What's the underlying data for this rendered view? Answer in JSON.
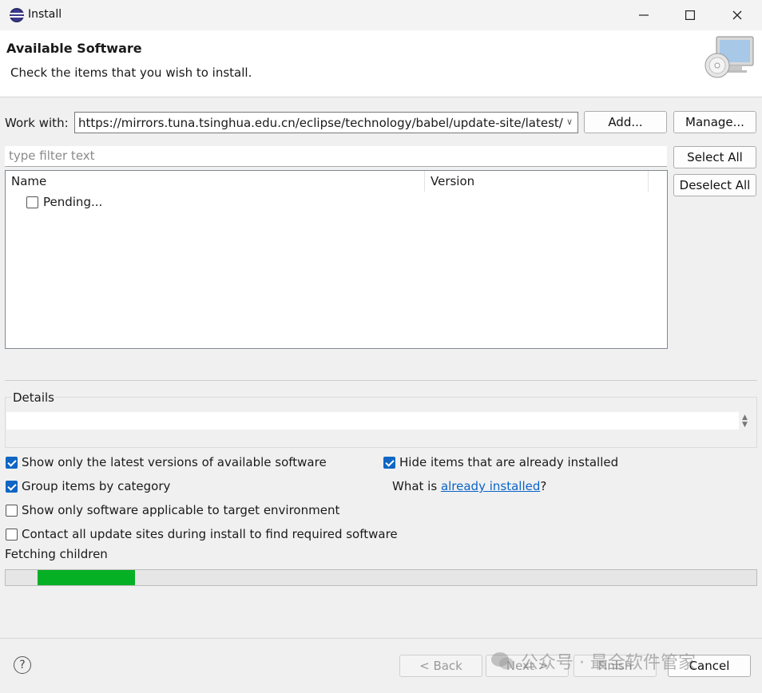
{
  "window": {
    "title": "Install",
    "minimize_icon": "minimize-icon",
    "maximize_icon": "maximize-icon",
    "close_icon": "close-icon"
  },
  "header": {
    "title": "Available Software",
    "subtitle": "Check the items that you wish to install."
  },
  "work_with": {
    "label": "Work with:",
    "value": "https://mirrors.tuna.tsinghua.edu.cn/eclipse/technology/babel/update-site/latest/",
    "add_label": "Add...",
    "manage_label": "Manage..."
  },
  "filter": {
    "placeholder": "type filter text"
  },
  "side_buttons": {
    "select_all": "Select All",
    "deselect_all": "Deselect All"
  },
  "table": {
    "columns": [
      "Name",
      "Version"
    ],
    "rows": [
      {
        "name": "Pending...",
        "checked": false
      }
    ]
  },
  "details": {
    "label": "Details",
    "text": ""
  },
  "options": {
    "latest_versions": {
      "label": "Show only the latest versions of available software",
      "checked": true
    },
    "group_by_category": {
      "label": "Group items by category",
      "checked": true
    },
    "target_env": {
      "label": "Show only software applicable to target environment",
      "checked": false
    },
    "contact_sites": {
      "label": "Contact all update sites during install to find required software",
      "checked": false
    },
    "hide_installed": {
      "label": "Hide items that are already installed",
      "checked": true
    },
    "what_is_prefix": "What is ",
    "what_is_link": "already installed",
    "what_is_suffix": "?"
  },
  "status": {
    "text": "Fetching children",
    "progress_fraction": 0.13
  },
  "footer": {
    "back": "< Back",
    "next": "Next >",
    "finish": "Finish",
    "cancel": "Cancel",
    "help_icon": "help-icon"
  },
  "watermark": "公众号 · 最全软件管家",
  "colors": {
    "accent": "#0f66c3",
    "progress": "#06b025",
    "link": "#0a64c8"
  }
}
